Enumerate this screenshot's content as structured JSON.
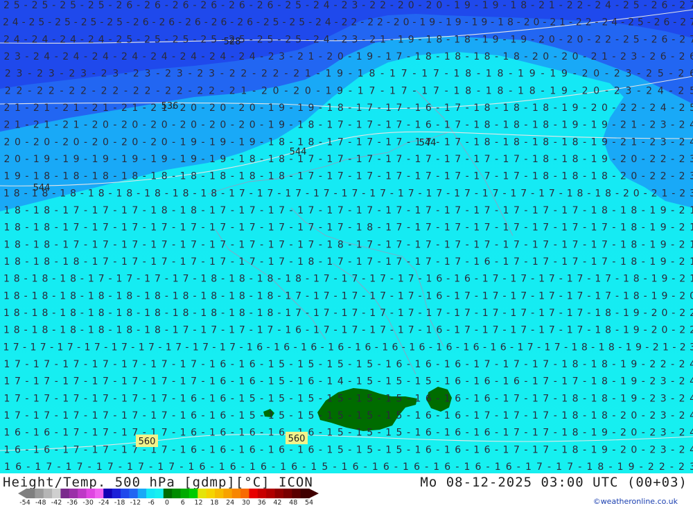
{
  "map": {
    "contour_labels_dam": [
      "528",
      "536",
      "544",
      "544",
      "544",
      "560",
      "560"
    ],
    "label_bg": "#f2f28a",
    "zone_colors": {
      "deep": "#1f49ec",
      "mid": "#2266f2",
      "light": "#19a9f7",
      "cyan": "#14e6f6",
      "warm_cyan": "#16f0f0",
      "green": "#006c00"
    },
    "temp_rows": [
      "25 25 25 25 26 26 26 26 26 26 25 24 23 22 20 20 19 19 18 21 22 24 25 26 27",
      "24 25 25 25 25 26 26 26 26 26 25 25 24 22 22 20 19 19 19 18 20 21 22 24 25 26 27",
      "24 24 24 24 25 25 25 25 25 25 25 24 23 21 19 18 18 19 19 20 20 22 25 26 27",
      "23 24 24 24 24 24 24 24 24 23 21 20 19 17 18 18 18 18 20 20 21 23 26 26",
      "23 23 23 23 23 23 23 22 22 21 19 18 17 17 18 18 19 19 20 23 25 26",
      "22 22 22 22 22 22 22 21 20 20 19 17 17 17 18 18 18 19 20 23 24 25",
      "21 21 21 21 21 21 20 20 20 19 19 18 17 17 16 17 18 18 18 19 20 22 24 25",
      "21 21 21 20 20 20 20 20 20 19 18 17 17 17 16 17 18 18 18 19 19 21 23 24",
      "20 20 20 20 20 20 19 19 19 18 18 17 17 17 17 17 18 18 18 18 19 21 23 24",
      "20 19 19 19 19 19 19 19 18 18 17 17 17 17 17 17 17 17 18 18 19 20 22 23",
      "19 18 18 18 18 18 18 18 18 18 17 17 17 17 17 17 17 17 18 18 18 20 22 23",
      "18 18 18 18 18 18 18 18 17 17 17 17 17 17 17 17 17 17 17 17 18 18 20 21 23",
      "18 18 17 17 17 18 18 17 17 17 17 17 17 17 17 17 17 17 17 17 18 18 19 21",
      "18 18 17 17 17 17 17 17 17 17 17 17 18 17 17 17 17 17 17 17 17 18 19 21",
      "18 18 17 17 17 17 17 17 17 17 17 18 17 17 17 17 17 17 17 17 17 18 19 21",
      "18 18 18 17 17 17 17 17 17 17 18 17 17 17 17 17 16 17 17 17 17 18 19 21",
      "18 18 18 17 17 17 17 18 18 18 18 17 17 17 17 16 16 17 17 17 17 17 18 19 21",
      "18 18 18 18 18 18 18 18 18 18 17 17 17 17 17 16 17 17 17 17 17 17 18 19 20",
      "18 18 18 18 18 18 18 18 18 18 17 17 17 17 17 17 17 17 17 17 17 18 19 20 22",
      "18 18 18 18 18 18 17 17 17 17 16 17 17 17 17 16 17 17 17 17 17 18 19 20 22",
      "17 17 17 17 17 17 17 17 17 16 16 16 16 16 16 16 16 16 16 17 17 18 18 19 21 23",
      "17 17 17 17 17 17 17 16 16 15 15 15 15 16 16 16 17 17 17 18 18 19 22 24",
      "17 17 17 17 17 17 17 16 16 15 16 14 15 15 15 16 16 16 17 17 18 19 23 24",
      "17 17 17 17 17 17 16 16 15 15 15 15 15 15 16 16 16 17 17 18 18 19 23 24",
      "17 17 17 17 17 17 16 16 15 15 15 15 15 15 16 16 17 17 17 18 18 20 23 24",
      "16 16 17 17 17 17 16 16 16 16 16 15 15 15 16 16 16 17 17 18 19 20 23 24",
      "16 16 17 17 17 17 16 16 16 16 16 15 15 15 16 16 16 17 17 18 19 20 23 24",
      "16 17 17 17 17 17 16 16 16 16 15 16 16 16 16 16 16 17 17 18 19 22 23"
    ]
  },
  "footer": {
    "title": "Height/Temp. 500 hPa [gdmp][°C] ICON",
    "datetime": "Mo 08-12-2025 03:00 UTC (00+03)",
    "credit": "©weatheronline.co.uk"
  },
  "legend": {
    "tick_labels": [
      "-54",
      "-48",
      "-42",
      "-36",
      "-30",
      "-24",
      "-18",
      "-12",
      "-6",
      "0",
      "6",
      "12",
      "18",
      "24",
      "30",
      "36",
      "42",
      "48",
      "54"
    ],
    "colors": [
      "#7f7f7f",
      "#9b9b9b",
      "#b5b5b5",
      "#cfcfcf",
      "#7a2a8c",
      "#9b2fa8",
      "#be39c6",
      "#df46e1",
      "#f062f0",
      "#1200b4",
      "#1c1fd8",
      "#1f49ec",
      "#2266f2",
      "#19a9f7",
      "#14e6f6",
      "#16f0f0",
      "#006c00",
      "#008c00",
      "#00ab00",
      "#00cc00",
      "#e4e40a",
      "#f5d400",
      "#f7bc00",
      "#f8a200",
      "#f88600",
      "#f86a00",
      "#e80000",
      "#c80000",
      "#b00000",
      "#900000",
      "#780000",
      "#5a0000",
      "#400000"
    ]
  }
}
